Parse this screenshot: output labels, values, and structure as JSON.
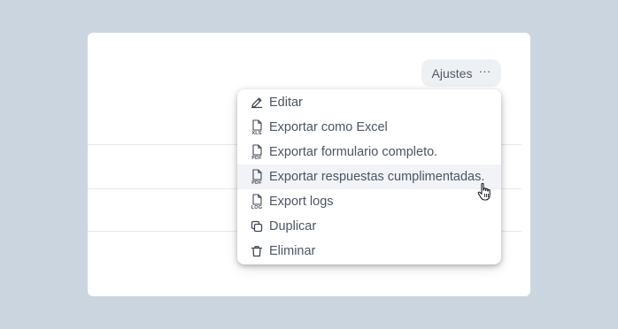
{
  "settings": {
    "label": "Ajustes",
    "more_glyph": "···"
  },
  "menu": {
    "items": [
      {
        "label": "Editar",
        "icon": "pencil-icon"
      },
      {
        "label": "Exportar como Excel",
        "icon": "file-icon",
        "file_tag": "XLS"
      },
      {
        "label": "Exportar formulario completo.",
        "icon": "file-icon",
        "file_tag": "PDF"
      },
      {
        "label": "Exportar respuestas cumplimentadas.",
        "icon": "file-icon",
        "file_tag": "PDF",
        "state": "hover"
      },
      {
        "label": "Export logs",
        "icon": "file-icon",
        "file_tag": "LOG"
      },
      {
        "label": "Duplicar",
        "icon": "copy-icon"
      },
      {
        "label": "Eliminar",
        "icon": "trash-icon"
      }
    ]
  },
  "colors": {
    "backdrop": "#cbd5df",
    "card": "#ffffff",
    "menu_text": "#4c5562",
    "hover_row": "#f1f3f6"
  }
}
